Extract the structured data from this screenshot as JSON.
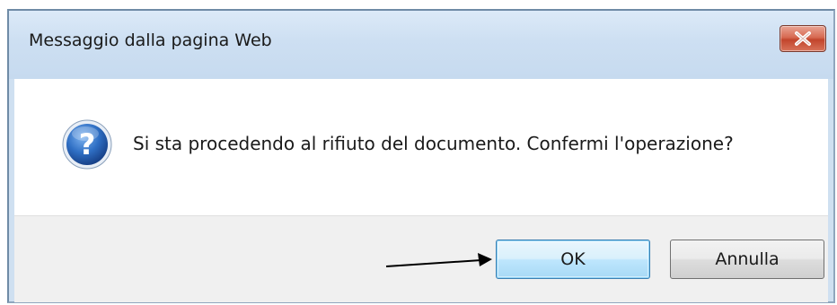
{
  "dialog": {
    "title": "Messaggio dalla pagina Web",
    "message": "Si sta procedendo al rifiuto del documento. Confermi l'operazione?",
    "icon": "question-icon",
    "close_icon": "close-icon"
  },
  "buttons": {
    "ok_label": "OK",
    "cancel_label": "Annulla"
  },
  "colors": {
    "title_bar": "#cddff2",
    "close_button": "#c2452c",
    "icon_blue": "#1f5fae",
    "default_button_border": "#3c7fb1"
  }
}
